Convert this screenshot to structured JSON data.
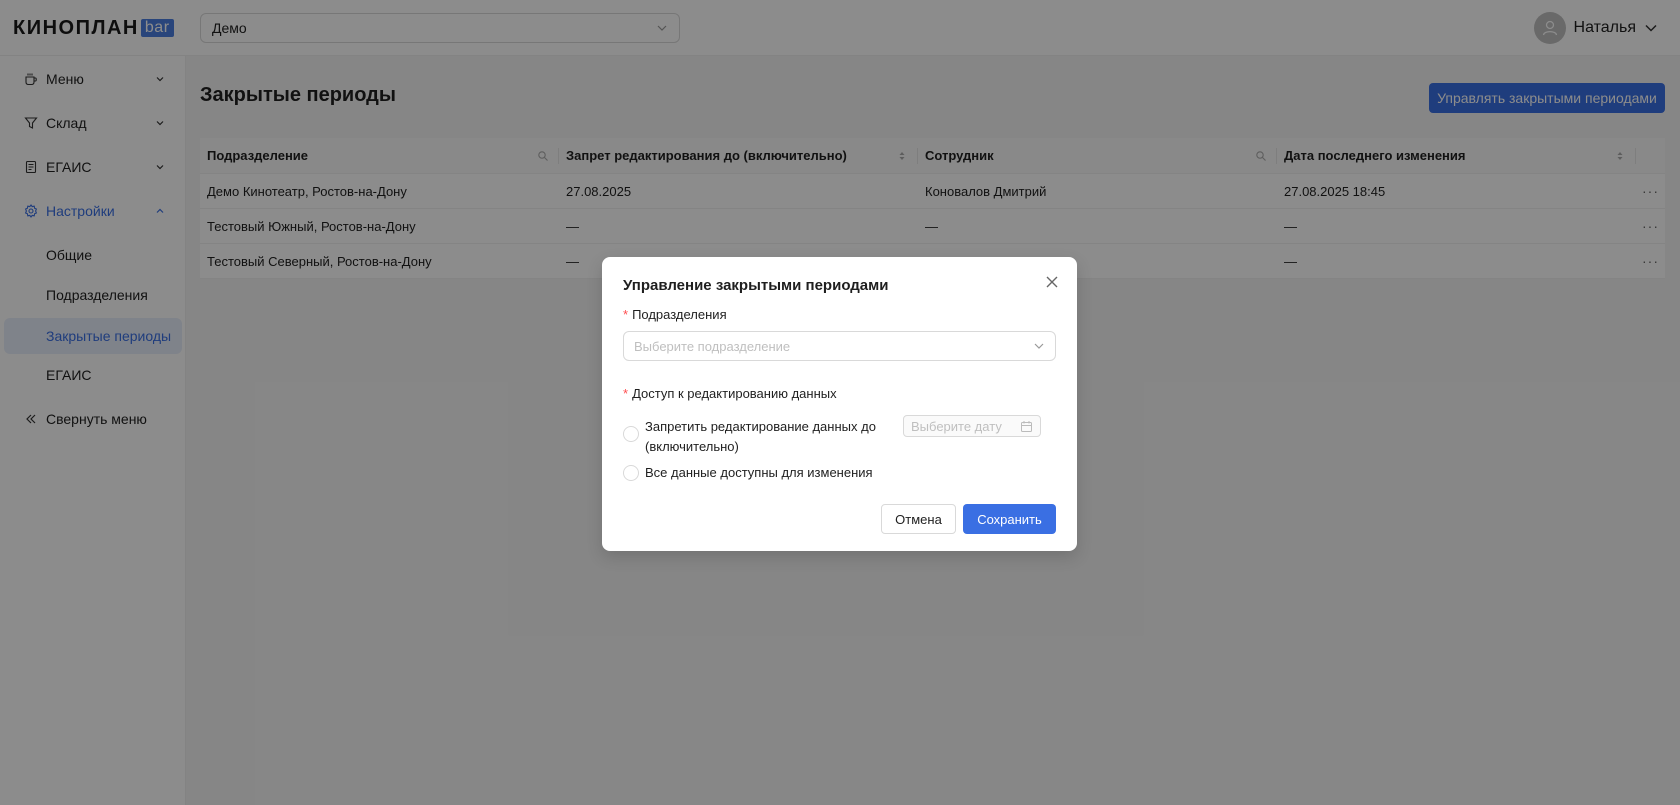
{
  "brand": {
    "name": "КИНОПЛАН",
    "tag": "bar"
  },
  "header": {
    "org_value": "Демо",
    "user_name": "Наталья"
  },
  "sidebar": {
    "items": [
      {
        "label": "Меню",
        "icon": "cup-icon"
      },
      {
        "label": "Склад",
        "icon": "funnel-icon"
      },
      {
        "label": "ЕГАИС",
        "icon": "document-icon"
      },
      {
        "label": "Настройки",
        "icon": "gear-icon"
      }
    ],
    "sub_items": [
      "Общие",
      "Подразделения",
      "Закрытые периоды",
      "ЕГАИС"
    ],
    "collapse_label": "Свернуть меню"
  },
  "page": {
    "title": "Закрытые периоды",
    "manage_button": "Управлять закрытыми периодами"
  },
  "table": {
    "headers": [
      "Подразделение",
      "Запрет редактирования до (включительно)",
      "Сотрудник",
      "Дата последнего изменения"
    ],
    "rows": [
      [
        "Демо Кинотеатр, Ростов-на-Дону",
        "27.08.2025",
        "Коновалов Дмитрий",
        "27.08.2025 18:45"
      ],
      [
        "Тестовый Южный, Ростов-на-Дону",
        "—",
        "—",
        "—"
      ],
      [
        "Тестовый Северный, Ростов-на-Дону",
        "—",
        "",
        "—"
      ]
    ],
    "row_action": "···"
  },
  "modal": {
    "title": "Управление закрытыми периодами",
    "dept_label": "Подразделения",
    "dept_placeholder": "Выберите подразделение",
    "access_label": "Доступ к редактированию данных",
    "option_restrict_line1": "Запретить редактирование данных до",
    "option_restrict_line2": "(включительно)",
    "date_placeholder": "Выберите дату",
    "option_all": "Все данные доступны для изменения",
    "cancel": "Отмена",
    "save": "Сохранить"
  },
  "colors": {
    "accent": "#3a6fe3",
    "required": "#ff4d4f"
  }
}
